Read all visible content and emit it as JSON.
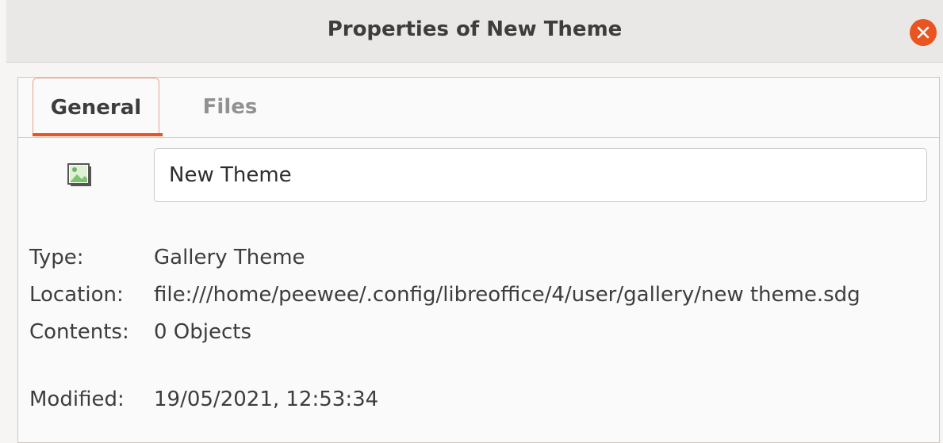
{
  "window": {
    "title": "Properties of New Theme"
  },
  "tabs": [
    {
      "label": "General",
      "active": true
    },
    {
      "label": "Files",
      "active": false
    }
  ],
  "general": {
    "name_value": "New Theme",
    "type_label": "Type:",
    "type_value": "Gallery Theme",
    "location_label": "Location:",
    "location_value": "file:///home/peewee/.config/libreoffice/4/user/gallery/new theme.sdg",
    "contents_label": "Contents:",
    "contents_value": "0 Objects",
    "modified_label": "Modified:",
    "modified_value": "19/05/2021, 12:53:34",
    "icon": "image-icon"
  },
  "colors": {
    "accent": "#e95420",
    "titlebar": "#e9e8e7",
    "background": "#f6f5f4"
  }
}
